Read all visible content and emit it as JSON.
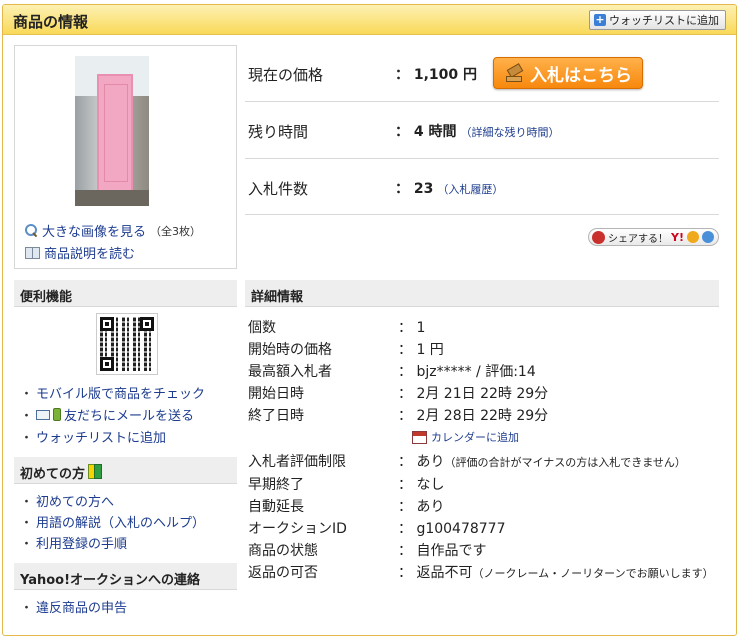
{
  "header": {
    "title": "商品の情報",
    "watchlist_button": "ウォッチリストに追加"
  },
  "image_panel": {
    "view_large": "大きな画像を見る",
    "count_note": "（全3枚）",
    "read_description": "商品説明を読む"
  },
  "price": {
    "current_label": "現在の価格",
    "current_value": "： 1,100 円",
    "bid_button": "入札はこちら",
    "remaining_label": "残り時間",
    "remaining_value": "： 4 時間",
    "remaining_link": "（詳細な残り時間）",
    "bids_label": "入札件数",
    "bids_value": "： 23",
    "bids_link": "（入札履歴）",
    "share_label": "シェアする！",
    "share_y": "Y!"
  },
  "convenience": {
    "title": "便利機能",
    "links": [
      "モバイル版で商品をチェック",
      "友だちにメールを送る",
      "ウォッチリストに追加"
    ]
  },
  "beginner": {
    "title": "初めての方",
    "links": [
      "初めての方へ",
      "用語の解説（入札のヘルプ）",
      "利用登録の手順"
    ]
  },
  "contact": {
    "title": "Yahoo!オークションへの連絡",
    "links": [
      "違反商品の申告"
    ]
  },
  "detail": {
    "title": "詳細情報",
    "rows": [
      {
        "k": "個数",
        "v": "： 1"
      },
      {
        "k": "開始時の価格",
        "v": "： 1 円"
      },
      {
        "k": "最高額入札者",
        "v": "： bjz***** / 評価:14"
      },
      {
        "k": "開始日時",
        "v": "： 2月 21日 22時 29分"
      },
      {
        "k": "終了日時",
        "v": "： 2月 28日 22時 29分"
      },
      {
        "k": "入札者評価制限",
        "v": "： あり",
        "note": "（評価の合計がマイナスの方は入札できません）"
      },
      {
        "k": "早期終了",
        "v": "： なし"
      },
      {
        "k": "自動延長",
        "v": "： あり"
      },
      {
        "k": "オークションID",
        "v": "： g100478777"
      },
      {
        "k": "商品の状態",
        "v": "： 自作品です"
      },
      {
        "k": "返品の可否",
        "v": "： 返品不可",
        "note": "（ノークレーム・ノーリターンでお願いします）"
      }
    ],
    "calendar_link": "カレンダーに追加"
  },
  "colors": {
    "header_bg": "#f9d959",
    "link": "#1d3c8f",
    "bid_button": "#f7880d"
  }
}
